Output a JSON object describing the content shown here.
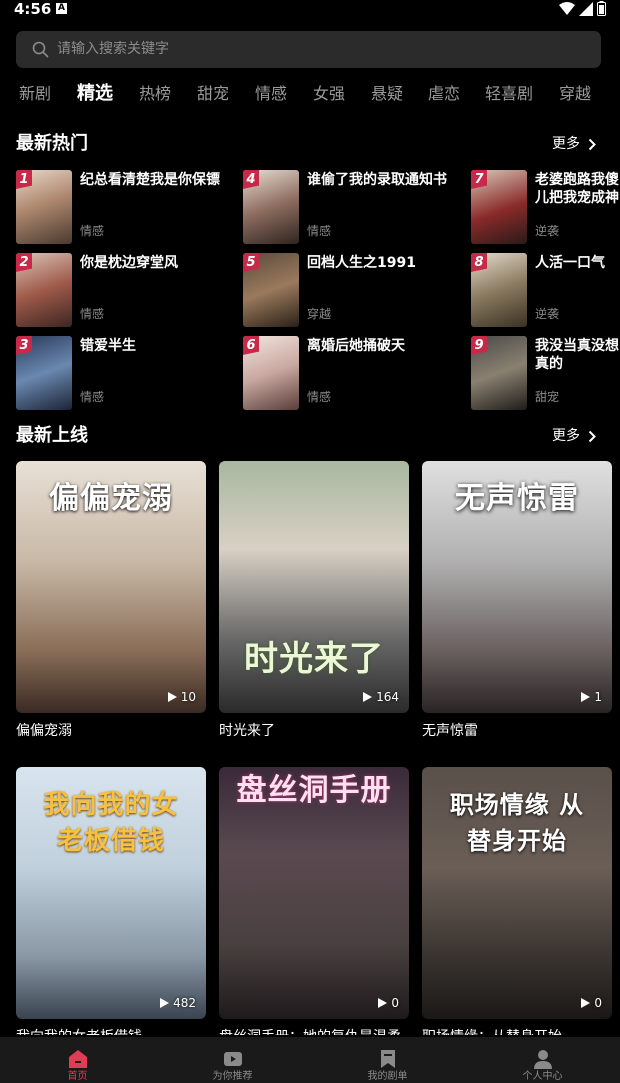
{
  "status_bar": {
    "time": "4:56",
    "notif_badge": "A"
  },
  "search": {
    "placeholder": "请输入搜索关键字"
  },
  "tabs": [
    "新剧",
    "精选",
    "热榜",
    "甜宠",
    "情感",
    "女强",
    "悬疑",
    "虐恋",
    "轻喜剧",
    "穿越"
  ],
  "active_tab": "精选",
  "hot_section": {
    "title": "最新热门",
    "more": "更多",
    "items": [
      {
        "rank": "1",
        "title": "纪总看清楚我是你保镖",
        "tag": "情感"
      },
      {
        "rank": "2",
        "title": "你是枕边穿堂风",
        "tag": "情感"
      },
      {
        "rank": "3",
        "title": "错爱半生",
        "tag": "情感"
      },
      {
        "rank": "4",
        "title": "谁偷了我的录取通知书",
        "tag": "情感"
      },
      {
        "rank": "5",
        "title": "回档人生之1991",
        "tag": "穿越"
      },
      {
        "rank": "6",
        "title": "离婚后她捅破天",
        "tag": "情感"
      },
      {
        "rank": "7",
        "title": "老婆跑路我傻儿把我宠成神",
        "tag": "逆袭"
      },
      {
        "rank": "8",
        "title": "人活一口气",
        "tag": "逆袭"
      },
      {
        "rank": "9",
        "title": "我没当真没想真的",
        "tag": "甜宠"
      }
    ]
  },
  "new_section": {
    "title": "最新上线",
    "more": "更多",
    "cards": [
      {
        "title": "偏偏宠溺",
        "cover_text": "偏偏宠溺",
        "plays": "10"
      },
      {
        "title": "时光来了",
        "cover_text": "时光来了",
        "plays": "164"
      },
      {
        "title": "无声惊雷",
        "cover_text": "无声惊雷",
        "plays": "1"
      },
      {
        "title": "我向我的女老板借钱",
        "cover_text": "我向我的女老板借钱",
        "plays": "482"
      },
      {
        "title": "盘丝洞手册：她的复仇是温柔",
        "cover_text": "盘丝洞手册",
        "plays": "0"
      },
      {
        "title": "职场情缘：从替身开始",
        "cover_text": "职场情缘 从替身开始",
        "plays": "0"
      }
    ]
  },
  "bottom_nav": [
    {
      "label": "首页",
      "icon": "home-icon",
      "active": true
    },
    {
      "label": "为你推荐",
      "icon": "video-icon",
      "active": false
    },
    {
      "label": "我的剧单",
      "icon": "bookmark-icon",
      "active": false
    },
    {
      "label": "个人中心",
      "icon": "user-icon",
      "active": false
    }
  ],
  "colors": {
    "accent": "#e23b55",
    "rank_badge": "#c62a48",
    "background": "#000000",
    "search_bg": "#2b2b2b"
  }
}
